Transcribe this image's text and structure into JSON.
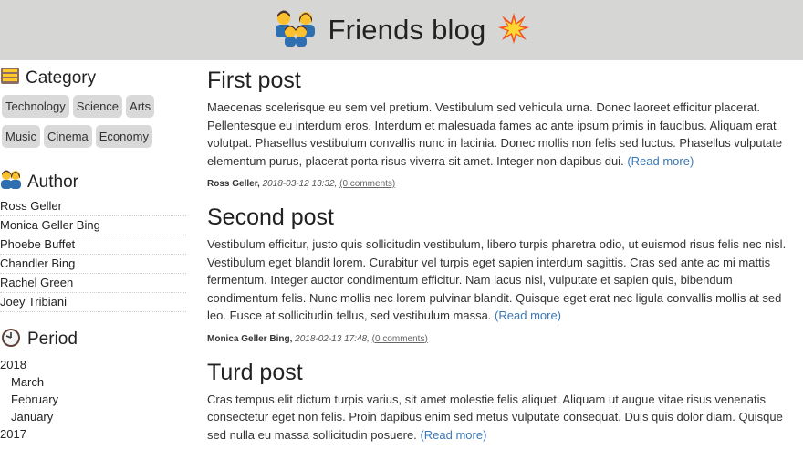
{
  "header": {
    "title": "Friends blog",
    "left_icon": "family-emoji-icon",
    "right_icon": "collision-emoji-icon"
  },
  "sidebar": {
    "category": {
      "title": "Category",
      "icon": "card-index-icon",
      "tags": [
        "Technology",
        "Science",
        "Arts",
        "Music",
        "Cinema",
        "Economy"
      ]
    },
    "author": {
      "title": "Author",
      "icon": "people-emoji-icon",
      "items": [
        "Ross Geller",
        "Monica Geller Bing",
        "Phoebe Buffet",
        "Chandler Bing",
        "Rachel Green",
        "Joey Tribiani"
      ]
    },
    "period": {
      "title": "Period",
      "icon": "clock-icon",
      "items": [
        {
          "label": "2018",
          "level": 0
        },
        {
          "label": "March",
          "level": 1
        },
        {
          "label": "February",
          "level": 1
        },
        {
          "label": "January",
          "level": 1
        },
        {
          "label": "2017",
          "level": 0
        }
      ]
    }
  },
  "posts": [
    {
      "title": "First post",
      "body": "Maecenas scelerisque eu sem vel pretium. Vestibulum sed vehicula urna. Donec laoreet efficitur placerat. Pellentesque eu interdum eros. Interdum et malesuada fames ac ante ipsum primis in faucibus. Aliquam erat volutpat. Phasellus vestibulum convallis nunc in lacinia. Donec mollis non felis sed luctus. Phasellus vulputate elementum purus, placerat porta risus viverra sit amet. Integer non dapibus dui.",
      "read_more": "(Read more)",
      "author": "Ross Geller,",
      "date": "2018-03-12 13:32,",
      "comments": "(0 comments)"
    },
    {
      "title": "Second post",
      "body": "Vestibulum efficitur, justo quis sollicitudin vestibulum, libero turpis pharetra odio, ut euismod risus felis nec nisl. Vestibulum eget blandit lorem. Curabitur vel turpis eget sapien interdum sagittis. Cras sed ante ac mi mattis fermentum. Integer auctor condimentum efficitur. Nam lacus nisl, vulputate et sapien quis, bibendum condimentum felis. Nunc mollis nec lorem pulvinar blandit. Quisque eget erat nec ligula convallis mollis at sed leo. Fusce at sollicitudin tellus, sed vestibulum massa.",
      "read_more": "(Read more)",
      "author": "Monica Geller Bing,",
      "date": "2018-02-13 17:48,",
      "comments": "(0 comments)"
    },
    {
      "title": "Turd post",
      "body": "Cras tempus elit dictum turpis varius, sit amet molestie felis aliquet. Aliquam ut augue vitae risus venenatis consectetur eget non felis. Proin dapibus enim sed metus vulputate consequat. Duis quis dolor diam. Quisque sed nulla eu massa sollicitudin posuere.",
      "read_more": "(Read more)"
    }
  ]
}
